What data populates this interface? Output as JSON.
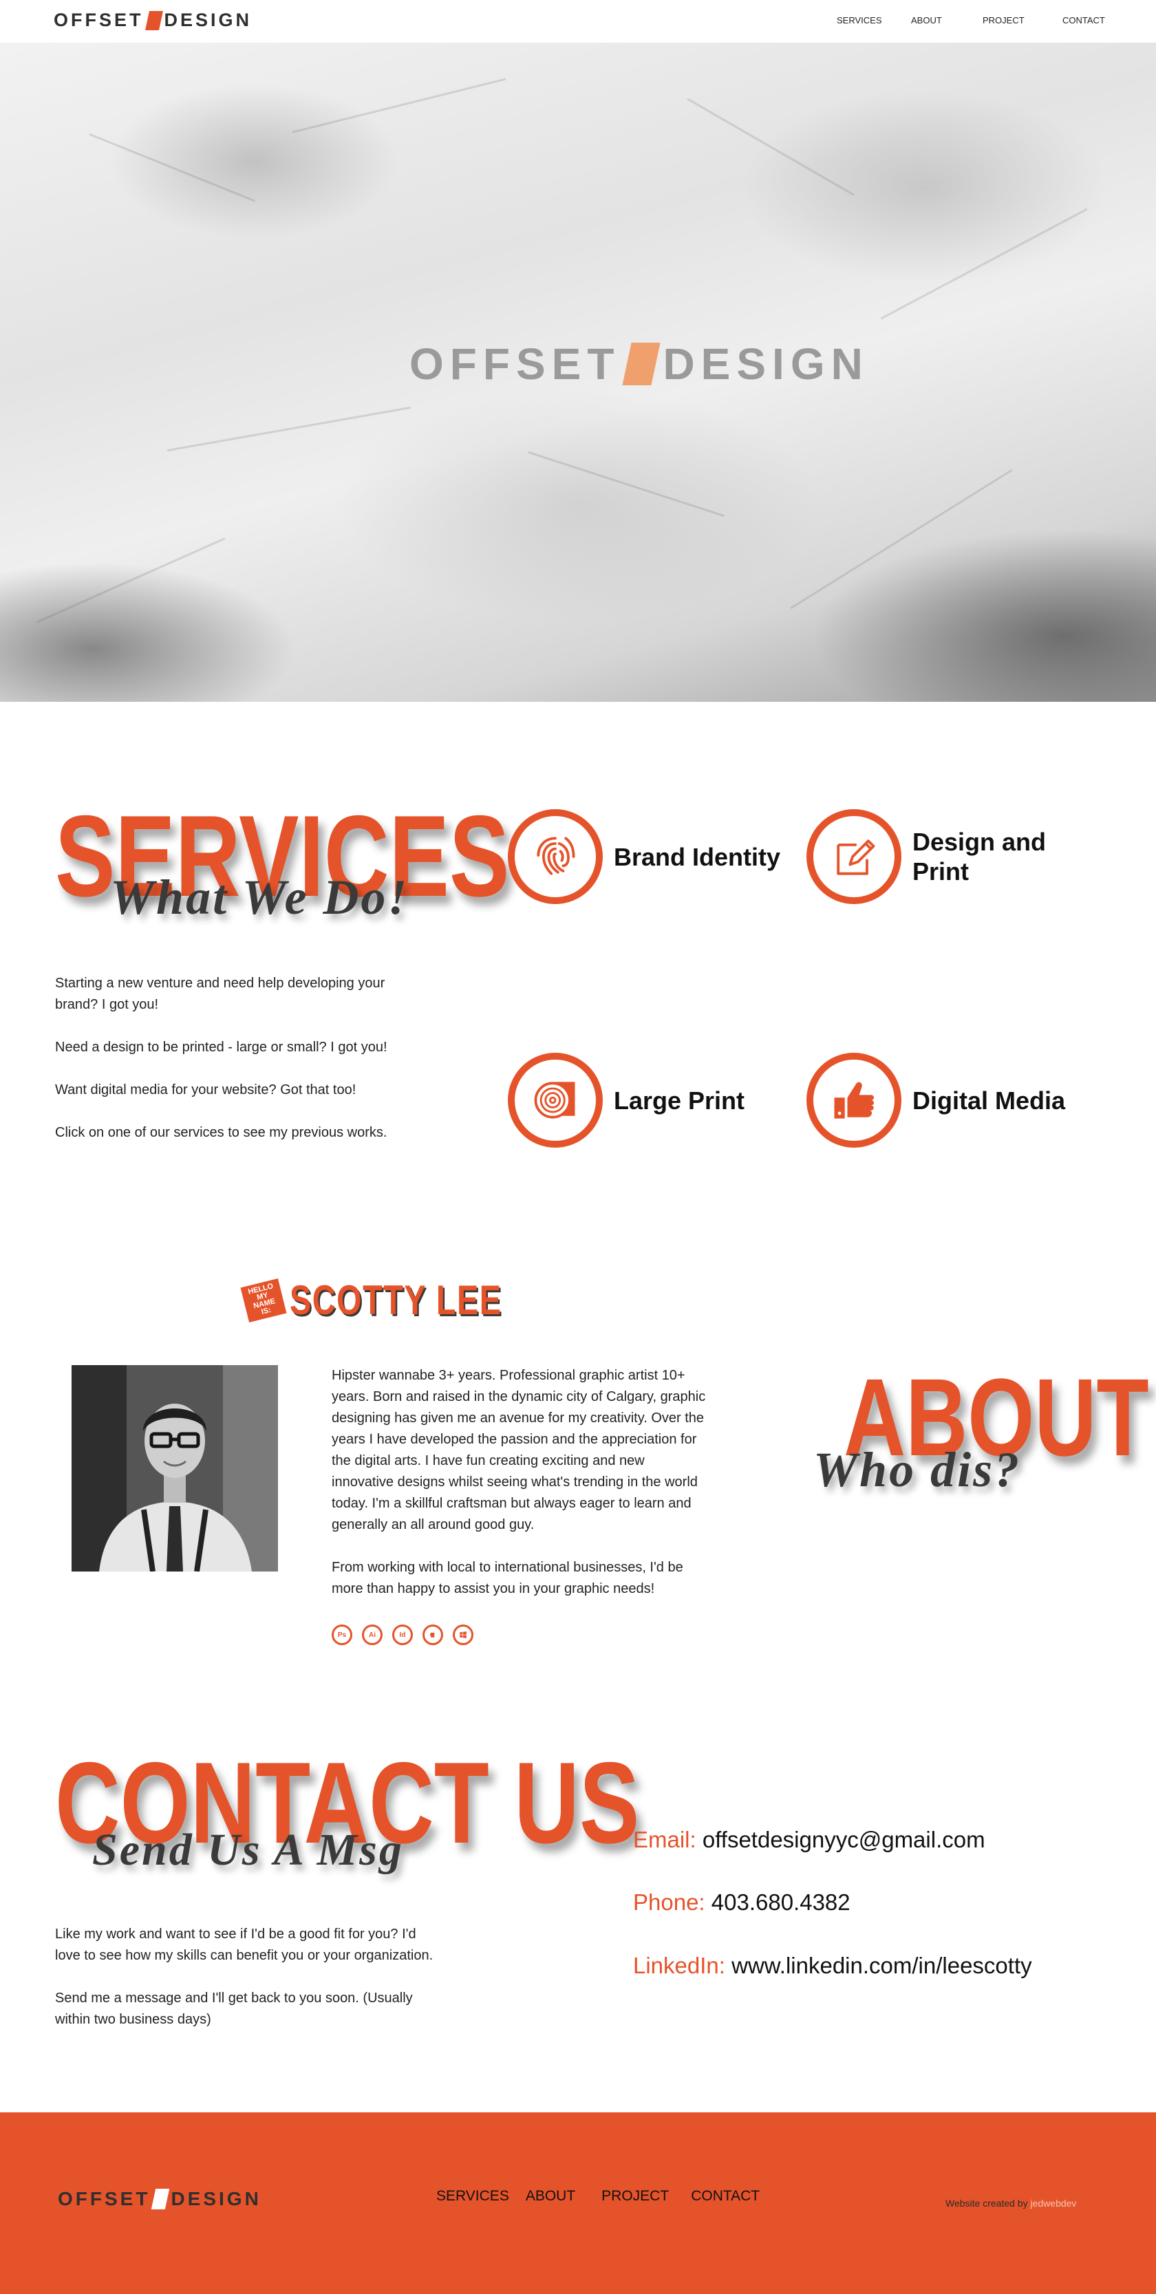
{
  "brand": {
    "logo_left": "OFFSET",
    "logo_right": "DESIGN"
  },
  "nav": {
    "services": "SERVICES",
    "about": "ABOUT",
    "project": "PROJECT",
    "contact": "CONTACT"
  },
  "colors": {
    "accent": "#e5532a",
    "dark": "#3a3a3a"
  },
  "services": {
    "title": "SERVICES",
    "subtitle": "What We Do!",
    "paragraphs": [
      "Starting a new venture and need help developing your brand? I got you!",
      "Need a design to be printed - large or small? I got you!",
      "Want digital media for your website? Got that too!",
      "Click on one of our services to see my previous works."
    ],
    "items": [
      {
        "label": "Brand Identity",
        "icon": "fingerprint-icon"
      },
      {
        "label": "Design and Print",
        "icon": "pencil-document-icon"
      },
      {
        "label": "Large Print",
        "icon": "paper-roll-icon"
      },
      {
        "label": "Digital Media",
        "icon": "thumbs-up-icon"
      }
    ]
  },
  "about": {
    "hello": "HELLO MY NAME IS:",
    "name": "SCOTTY LEE",
    "title": "ABOUT",
    "subtitle": "Who dis?",
    "paragraphs": [
      "Hipster wannabe 3+ years. Professional graphic artist 10+ years. Born and raised in the dynamic city of Calgary, graphic designing has given me an avenue for my creativity. Over the years I have developed the passion and the appreciation for the digital arts. I have fun creating exciting and new innovative designs whilst seeing what's trending in the world today. I'm a skillful craftsman but always eager to learn and generally an all around good guy.",
      "From working with local to international businesses, I'd be more than happy to assist you in your graphic needs!"
    ],
    "tools": [
      "Ps",
      "Ai",
      "Id",
      "apple-icon",
      "windows-icon"
    ]
  },
  "contact": {
    "title": "CONTACT US",
    "subtitle": "Send Us A Msg",
    "paragraphs": [
      "Like my work and want to see if I'd be a good fit for you? I'd love to see how my skills can benefit you or your organization.",
      "Send me a message and I'll get back to you soon. (Usually within two business days)"
    ],
    "email_label": "Email:",
    "email": "offsetdesignyyc@gmail.com",
    "phone_label": "Phone:",
    "phone": "403.680.4382",
    "linkedin_label": "LinkedIn:",
    "linkedin": "www.linkedin.com/in/leescotty"
  },
  "footer": {
    "links": [
      "SERVICES",
      "ABOUT",
      "PROJECT",
      "CONTACT"
    ],
    "credit": "Website created by",
    "credit_dev": "jedwebdev"
  }
}
